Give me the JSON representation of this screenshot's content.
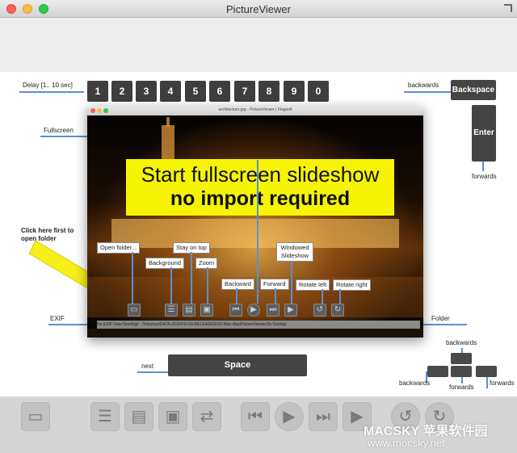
{
  "window": {
    "title": "PictureViewer"
  },
  "labels": {
    "delay": "Delay [1.. 10 sec]",
    "fullscreen": "Fullscreen",
    "click_first": "Click here first to open folder",
    "exif": "EXIF",
    "folder": "Folder",
    "next": "next",
    "backwards_top": "backwards",
    "forwards_right": "forwards",
    "backwards_arrows_top": "backwards",
    "backwards_arrows_left": "backwards",
    "forwards_arrows_bottom": "forwards",
    "forwards_arrows_right": "forwards"
  },
  "digits": [
    "1",
    "2",
    "3",
    "4",
    "5",
    "6",
    "7",
    "8",
    "9",
    "0"
  ],
  "keys": {
    "backspace": "Backspace",
    "enter": "Enter",
    "space": "Space"
  },
  "inner": {
    "title": "architecture.jpg - PictureViewer | Flagsoft",
    "banner_line1": "Start fullscreen slideshow",
    "banner_line2": "no import required",
    "status_left": "No EXIF DateTimeDigit",
    "status_path": "/Volumes/DATA-2015/FG-04-RELEASED/G2-Mac-App/PictureViewer/3x-Testing/",
    "callouts": {
      "open_folder": "Open folder...",
      "stay_on_top": "Stay on top",
      "background": "Background",
      "zoom": "Zoom",
      "windowed_slideshow": "Windowed Slideshow",
      "backward": "Backward",
      "forward": "Forward",
      "rotate_left": "Rotate left",
      "rotate_right": "Rotate right"
    }
  },
  "watermark": {
    "brand": "MACSKY 苹果软件园",
    "url": "www.mocsky.net"
  },
  "colors": {
    "banner": "#f6f403",
    "accent_line": "#5b8fd6",
    "key": "#444444"
  }
}
